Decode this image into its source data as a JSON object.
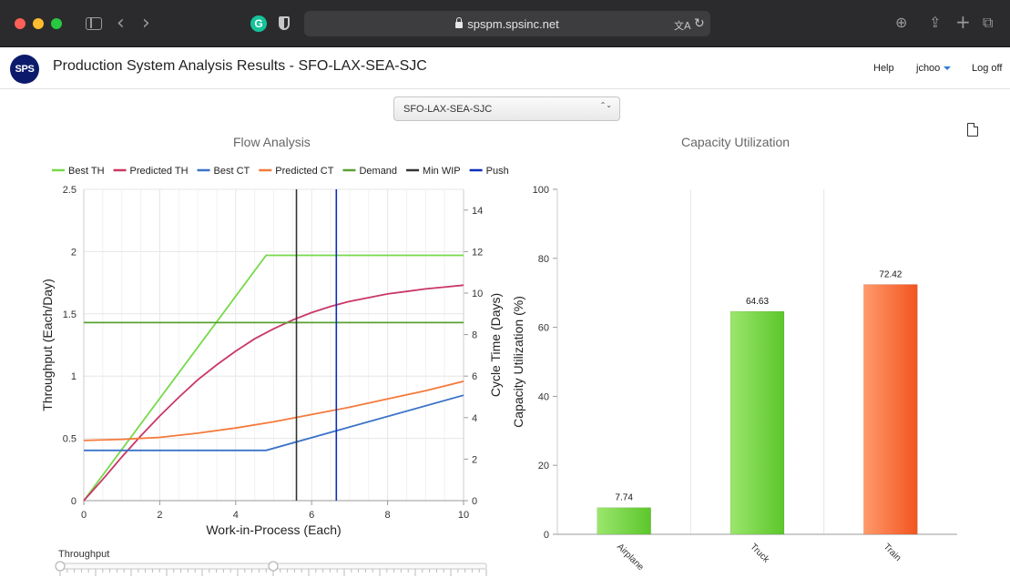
{
  "browser": {
    "address": "spspm.spsinc.net",
    "back_glyph": "‹",
    "forward_glyph": "›",
    "grammarly_glyph": "G",
    "translate_glyph": "文A",
    "reload_glyph": "↻",
    "download_glyph": "⊕",
    "share_glyph": "⇪",
    "newtab_glyph": "+",
    "tabs_glyph": "⧉"
  },
  "header": {
    "logo": "SPS",
    "title": "Production System Analysis Results - SFO-LAX-SEA-SJC",
    "nav": {
      "help": "Help",
      "user": "jchoo",
      "logoff": "Log off"
    }
  },
  "scenario_select": {
    "value": "SFO-LAX-SEA-SJC",
    "arrows": "⌃⌄"
  },
  "slider": {
    "label": "Throughput",
    "value_fraction": 0.5
  },
  "chart_data": [
    {
      "type": "line",
      "title": "Flow Analysis",
      "xlabel": "Work-in-Process (Each)",
      "ylabel": "Throughput (Each/Day)",
      "y2label": "Cycle Time (Days)",
      "xlim": [
        0,
        10
      ],
      "ylim": [
        0,
        2.5
      ],
      "y2lim": [
        0,
        15
      ],
      "x_ticks": [
        "0",
        "2",
        "4",
        "6",
        "8",
        "10"
      ],
      "y_ticks": [
        "0",
        "0.5",
        "1",
        "1.5",
        "2",
        "2.5"
      ],
      "y2_ticks": [
        "0",
        "2",
        "4",
        "6",
        "8",
        "10",
        "12",
        "14"
      ],
      "legend_position": "top",
      "grid": true,
      "series": [
        {
          "name": "Best TH",
          "axis": "left",
          "color": "#76d94a",
          "x": [
            0,
            4.8,
            10
          ],
          "y": [
            0,
            1.97,
            1.97
          ]
        },
        {
          "name": "Predicted TH",
          "axis": "left",
          "color": "#c93865",
          "x": [
            0,
            0.5,
            1,
            1.5,
            2,
            2.5,
            3,
            3.5,
            4,
            4.5,
            5,
            5.5,
            6,
            6.5,
            7,
            7.5,
            8,
            8.5,
            9,
            9.5,
            10
          ],
          "y": [
            0,
            0.17,
            0.35,
            0.52,
            0.68,
            0.83,
            0.97,
            1.09,
            1.2,
            1.3,
            1.38,
            1.45,
            1.51,
            1.56,
            1.6,
            1.63,
            1.66,
            1.68,
            1.7,
            1.715,
            1.73
          ]
        },
        {
          "name": "Best CT",
          "axis": "right",
          "color": "#3b73c8",
          "x": [
            0,
            4.8,
            10
          ],
          "y": [
            2.42,
            2.42,
            5.08
          ]
        },
        {
          "name": "Predicted CT",
          "axis": "right",
          "color": "#f57a3c",
          "x": [
            0,
            1,
            2,
            3,
            4,
            5,
            6,
            7,
            8,
            9,
            10
          ],
          "y": [
            2.9,
            2.95,
            3.05,
            3.25,
            3.5,
            3.8,
            4.15,
            4.5,
            4.9,
            5.3,
            5.75
          ]
        },
        {
          "name": "Demand",
          "axis": "left",
          "color": "#5aa131",
          "x": [
            0,
            10
          ],
          "y": [
            1.43,
            1.43
          ]
        },
        {
          "name": "Min WIP",
          "axis": "vertical",
          "color": "#333333",
          "x_value": 5.6
        },
        {
          "name": "Push WIP",
          "axis": "vertical",
          "color": "#0a2fb8",
          "x_value": 6.65
        }
      ]
    },
    {
      "type": "bar",
      "title": "Capacity Utilization",
      "ylabel": "Capacity Utilization (%)",
      "ylim": [
        0,
        100
      ],
      "y_ticks": [
        "0",
        "20",
        "40",
        "60",
        "80",
        "100"
      ],
      "categories": [
        "Airplane",
        "Truck",
        "Train"
      ],
      "values": [
        7.74,
        64.63,
        72.42
      ],
      "labels": [
        "7.74",
        "64.63",
        "72.42"
      ],
      "colors": [
        [
          "#9be66d",
          "#5cc62b"
        ],
        [
          "#9be66d",
          "#5cc62b"
        ],
        [
          "#ff9a6b",
          "#f2541f"
        ]
      ],
      "grid": "vertical"
    }
  ]
}
